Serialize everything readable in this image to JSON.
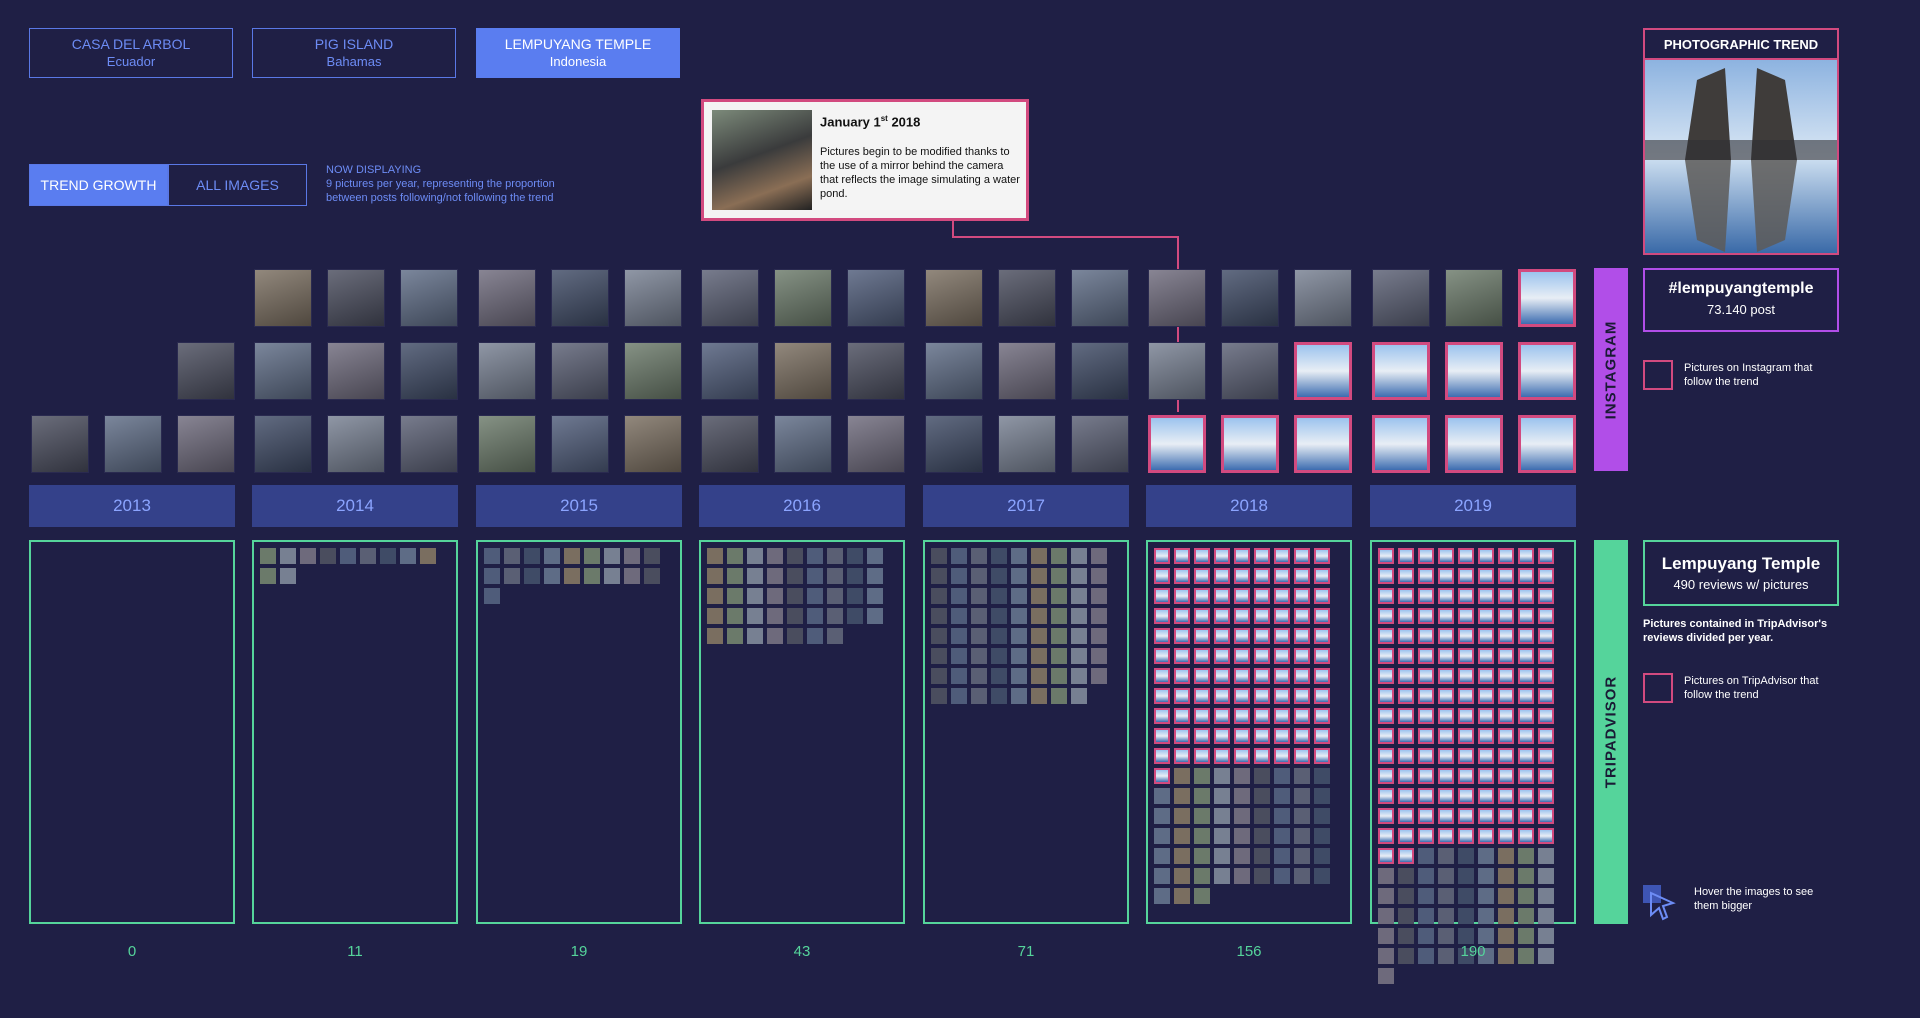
{
  "locations": [
    {
      "name": "CASA DEL ARBOL",
      "country": "Ecuador",
      "active": false
    },
    {
      "name": "PIG ISLAND",
      "country": "Bahamas",
      "active": false
    },
    {
      "name": "LEMPUYANG TEMPLE",
      "country": "Indonesia",
      "active": true
    }
  ],
  "modes": {
    "trend": "TREND GROWTH",
    "all": "ALL IMAGES"
  },
  "display": {
    "label": "NOW DISPLAYING",
    "desc1": "9 pictures per year, representing the proportion",
    "desc2": "between posts following/not following the trend"
  },
  "tooltip": {
    "date_main": "January 1",
    "date_sup": "st",
    "date_year": " 2018",
    "text": "Pictures begin to be modified thanks to the use of a mirror behind the camera that reflects the image simulating a water pond."
  },
  "years": [
    "2013",
    "2014",
    "2015",
    "2016",
    "2017",
    "2018",
    "2019"
  ],
  "instagram_images_per_year": [
    {
      "total": 4,
      "trend": 0
    },
    {
      "total": 9,
      "trend": 0
    },
    {
      "total": 9,
      "trend": 0
    },
    {
      "total": 9,
      "trend": 0
    },
    {
      "total": 9,
      "trend": 0
    },
    {
      "total": 9,
      "trend": 4
    },
    {
      "total": 9,
      "trend": 7
    }
  ],
  "tripadvisor_counts": [
    "0",
    "11",
    "19",
    "43",
    "71",
    "156",
    "190"
  ],
  "tripadvisor_trend_counts": [
    0,
    0,
    0,
    0,
    0,
    100,
    137
  ],
  "side": {
    "instagram": "INSTAGRAM",
    "tripadvisor": "TRIPADVISOR"
  },
  "pane": {
    "title": "PHOTOGRAPHIC TREND",
    "hashtag": "#lempuyangtemple",
    "posts": "73.140 post",
    "ig_legend": "Pictures on Instagram that follow the trend",
    "ta_title": "Lempuyang Temple",
    "ta_reviews": "490 reviews w/ pictures",
    "ta_desc": "Pictures contained in TripAdvisor's reviews divided per year.",
    "ta_legend": "Pictures on TripAdvisor that follow the trend",
    "hover": "Hover the images to see them bigger"
  },
  "colors": {
    "bg": "#1f1f45",
    "accent": "#5a7df0",
    "trend": "#d24a7f",
    "instagram": "#b14ee8",
    "tripadvisor": "#55d49b"
  }
}
